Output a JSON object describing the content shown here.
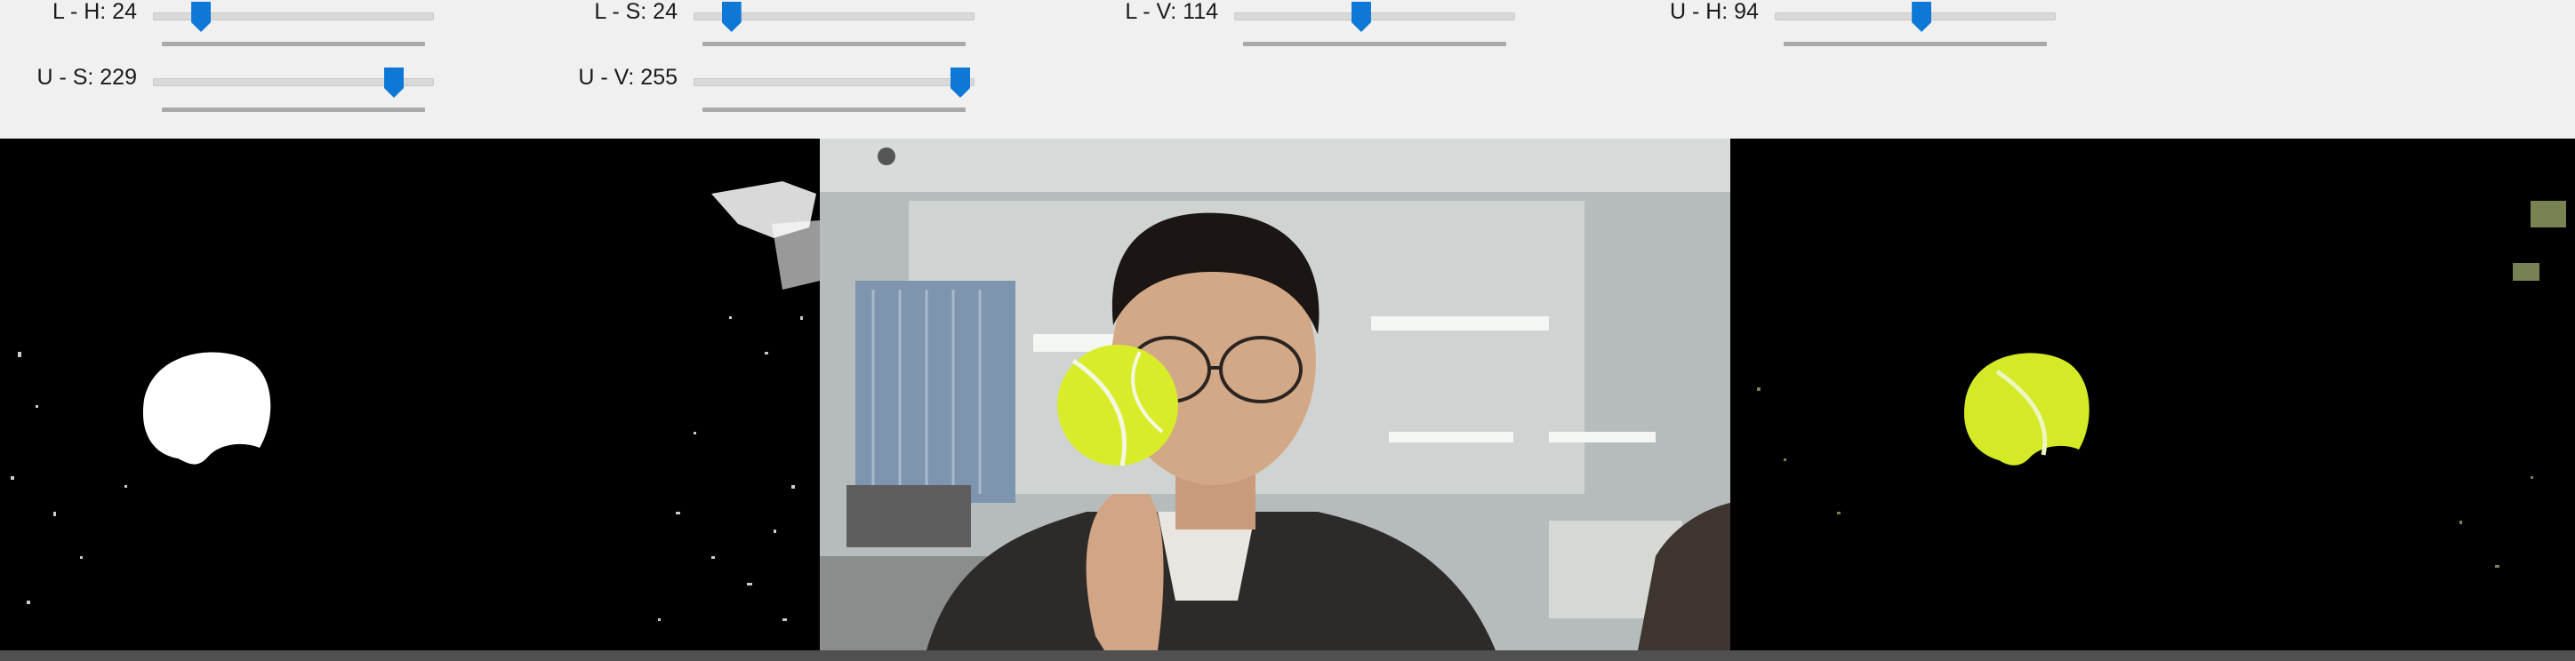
{
  "sliders": [
    {
      "id": "l-h",
      "label": "L - H: 24",
      "value": 24,
      "max": 179
    },
    {
      "id": "l-s",
      "label": "L - S: 24",
      "value": 24,
      "max": 255
    },
    {
      "id": "l-v",
      "label": "L - V: 114",
      "value": 114,
      "max": 255
    },
    {
      "id": "u-h",
      "label": "U - H: 94",
      "value": 94,
      "max": 179
    },
    {
      "id": "u-s",
      "label": "U - S: 229",
      "value": 229,
      "max": 255
    },
    {
      "id": "u-v",
      "label": "U - V: 255",
      "value": 255,
      "max": 255
    }
  ],
  "panes": [
    {
      "id": "mask",
      "content": "binary mask (white ball blob on black)"
    },
    {
      "id": "frame",
      "content": "camera frame: person holding yellow tennis ball"
    },
    {
      "id": "result",
      "content": "masked result (yellow ball on black)"
    }
  ],
  "colors": {
    "thumb": "#0e78d6",
    "background": "#f0f0f0",
    "ball": "#d9ec2a"
  }
}
